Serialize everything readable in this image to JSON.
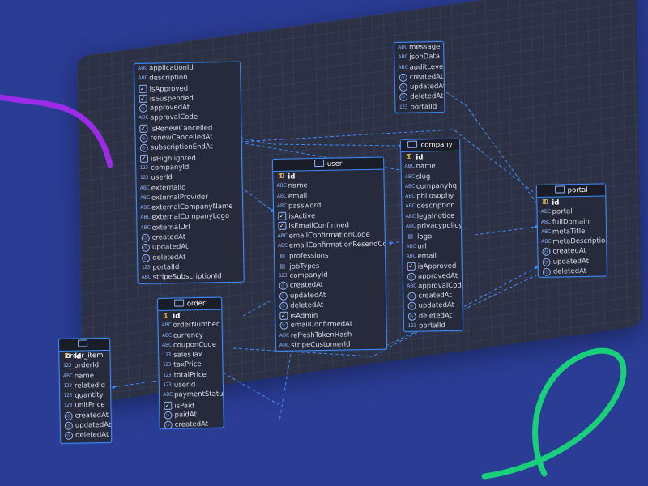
{
  "colors": {
    "background": "#2a3c94",
    "board": "#2d3144",
    "table_border": "#3d8dff",
    "relation_line": "#3d8dff",
    "ribbon_purple": "#9b2be8",
    "ribbon_green": "#18d07a"
  },
  "tables": [
    {
      "id": "subscription",
      "title": "",
      "fields": [
        {
          "icon": "abc",
          "name": "applicationId"
        },
        {
          "icon": "abc",
          "name": "description"
        },
        {
          "icon": "check",
          "name": "isApproved"
        },
        {
          "icon": "check",
          "name": "isSuspended"
        },
        {
          "icon": "clock",
          "name": "approvedAt"
        },
        {
          "icon": "abc",
          "name": "approvalCode"
        },
        {
          "icon": "check",
          "name": "isRenewCancelled"
        },
        {
          "icon": "clock",
          "name": "renewCancelledAt"
        },
        {
          "icon": "clock",
          "name": "subscriptionEndAt"
        },
        {
          "icon": "check",
          "name": "isHighlighted"
        },
        {
          "icon": "num",
          "name": "companyId"
        },
        {
          "icon": "num",
          "name": "userId"
        },
        {
          "icon": "abc",
          "name": "externalId"
        },
        {
          "icon": "abc",
          "name": "externalProvider"
        },
        {
          "icon": "abc",
          "name": "externalCompanyName"
        },
        {
          "icon": "abc",
          "name": "externalCompanyLogo"
        },
        {
          "icon": "abc",
          "name": "externalUrl"
        },
        {
          "icon": "clock",
          "name": "createdAt"
        },
        {
          "icon": "clock",
          "name": "updatedAt"
        },
        {
          "icon": "clock",
          "name": "deletedAt"
        },
        {
          "icon": "num",
          "name": "portalId"
        },
        {
          "icon": "abc",
          "name": "stripeSubscriptionId"
        }
      ]
    },
    {
      "id": "audit",
      "title": "",
      "fields": [
        {
          "icon": "abc",
          "name": "message"
        },
        {
          "icon": "abc",
          "name": "jsonData"
        },
        {
          "icon": "abc",
          "name": "auditLevel"
        },
        {
          "icon": "clock",
          "name": "createdAt"
        },
        {
          "icon": "clock",
          "name": "updatedAt"
        },
        {
          "icon": "clock",
          "name": "deletedAt"
        },
        {
          "icon": "num",
          "name": "portalId"
        }
      ]
    },
    {
      "id": "user",
      "title": "user",
      "fields": [
        {
          "icon": "key",
          "name": "id",
          "pk": true
        },
        {
          "icon": "abc",
          "name": "name"
        },
        {
          "icon": "abc",
          "name": "email"
        },
        {
          "icon": "abc",
          "name": "password"
        },
        {
          "icon": "check",
          "name": "isActive"
        },
        {
          "icon": "check",
          "name": "isEmailConfirmed"
        },
        {
          "icon": "abc",
          "name": "emailConfirmationCode"
        },
        {
          "icon": "abc",
          "name": "emailConfirmationResendCode"
        },
        {
          "icon": "list",
          "name": "professions"
        },
        {
          "icon": "list",
          "name": "jobTypes"
        },
        {
          "icon": "num",
          "name": "companyId"
        },
        {
          "icon": "clock",
          "name": "createdAt"
        },
        {
          "icon": "clock",
          "name": "updatedAt"
        },
        {
          "icon": "clock",
          "name": "deletedAt"
        },
        {
          "icon": "check",
          "name": "isAdmin"
        },
        {
          "icon": "clock",
          "name": "emailConfirmedAt"
        },
        {
          "icon": "abc",
          "name": "refreshTokenHash"
        },
        {
          "icon": "abc",
          "name": "stripeCustomerId"
        }
      ]
    },
    {
      "id": "company",
      "title": "company",
      "fields": [
        {
          "icon": "key",
          "name": "id",
          "pk": true
        },
        {
          "icon": "abc",
          "name": "name"
        },
        {
          "icon": "abc",
          "name": "slug"
        },
        {
          "icon": "abc",
          "name": "companyhq"
        },
        {
          "icon": "abc",
          "name": "philosophy"
        },
        {
          "icon": "abc",
          "name": "description"
        },
        {
          "icon": "abc",
          "name": "legalnotice"
        },
        {
          "icon": "abc",
          "name": "privacypolicy"
        },
        {
          "icon": "list",
          "name": "logo"
        },
        {
          "icon": "abc",
          "name": "url"
        },
        {
          "icon": "abc",
          "name": "email"
        },
        {
          "icon": "check",
          "name": "isApproved"
        },
        {
          "icon": "clock",
          "name": "approvedAt"
        },
        {
          "icon": "abc",
          "name": "approvalCode"
        },
        {
          "icon": "clock",
          "name": "createdAt"
        },
        {
          "icon": "clock",
          "name": "updatedAt"
        },
        {
          "icon": "clock",
          "name": "deletedAt"
        },
        {
          "icon": "num",
          "name": "portalId"
        }
      ]
    },
    {
      "id": "portal",
      "title": "portal",
      "fields": [
        {
          "icon": "key",
          "name": "id",
          "pk": true
        },
        {
          "icon": "abc",
          "name": "portal"
        },
        {
          "icon": "abc",
          "name": "fullDomain"
        },
        {
          "icon": "abc",
          "name": "metaTitle"
        },
        {
          "icon": "abc",
          "name": "metaDescription"
        },
        {
          "icon": "clock",
          "name": "createdAt"
        },
        {
          "icon": "clock",
          "name": "updatedAt"
        },
        {
          "icon": "clock",
          "name": "deletedAt"
        }
      ]
    },
    {
      "id": "order",
      "title": "order",
      "fields": [
        {
          "icon": "key",
          "name": "id",
          "pk": true
        },
        {
          "icon": "abc",
          "name": "orderNumber"
        },
        {
          "icon": "abc",
          "name": "currency"
        },
        {
          "icon": "abc",
          "name": "couponCode"
        },
        {
          "icon": "num",
          "name": "salesTax"
        },
        {
          "icon": "num",
          "name": "taxPrice"
        },
        {
          "icon": "num",
          "name": "totalPrice"
        },
        {
          "icon": "num",
          "name": "userId"
        },
        {
          "icon": "abc",
          "name": "paymentStatus"
        },
        {
          "icon": "check",
          "name": "isPaid"
        },
        {
          "icon": "clock",
          "name": "paidAt"
        },
        {
          "icon": "clock",
          "name": "createdAt"
        }
      ]
    },
    {
      "id": "order_item",
      "title": "order_item",
      "fields": [
        {
          "icon": "key",
          "name": "id",
          "pk": true
        },
        {
          "icon": "num",
          "name": "orderId"
        },
        {
          "icon": "abc",
          "name": "name"
        },
        {
          "icon": "num",
          "name": "relatedId"
        },
        {
          "icon": "num",
          "name": "quantity"
        },
        {
          "icon": "num",
          "name": "unitPrice"
        },
        {
          "icon": "clock",
          "name": "createdAt"
        },
        {
          "icon": "clock",
          "name": "updatedAt"
        },
        {
          "icon": "clock",
          "name": "deletedAt"
        }
      ]
    }
  ]
}
